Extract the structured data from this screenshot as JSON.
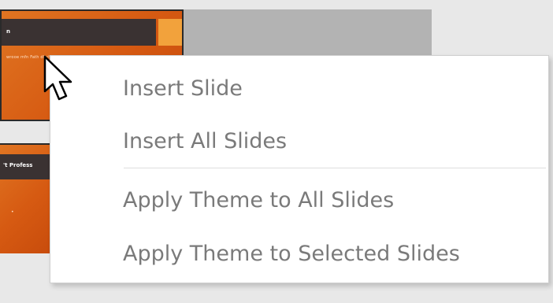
{
  "thumbnails": [
    {
      "title": "n",
      "body": "wrooe mfn Fath dhyh nhrnnD nn wf ohaln ugn"
    },
    {
      "title": "'t Profess",
      "body": "•"
    }
  ],
  "context_menu": {
    "items": [
      {
        "label": "Insert Slide"
      },
      {
        "label": "Insert All Slides"
      },
      {
        "label": "Apply Theme to All Slides"
      },
      {
        "label": "Apply Theme to Selected Slides"
      }
    ]
  },
  "colors": {
    "slide_gradient_start": "#e07522",
    "slide_gradient_end": "#c84c0c",
    "slide_title_bar": "#3a3232",
    "slide_accent": "#f2a23c",
    "menu_text": "#7a7a7a",
    "menu_background": "#ffffff"
  },
  "icons": {
    "cursor": "arrow-cursor-icon"
  }
}
